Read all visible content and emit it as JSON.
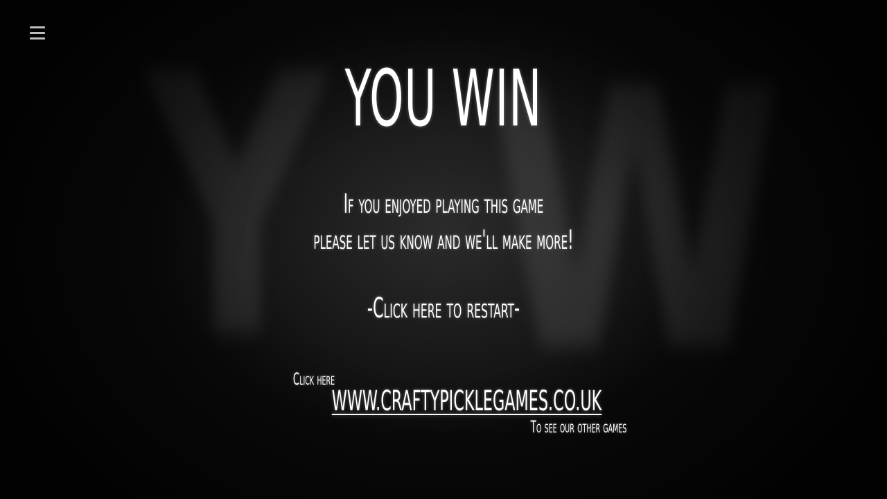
{
  "game": {
    "menu_icon": "hamburger-menu-icon",
    "background_letters": "YW",
    "title": "YOU WIN",
    "message_line_1": "If you enjoyed playing this game",
    "message_line_2": "please let us know and we'll make more!",
    "restart_label": "-Click here to restart-",
    "click_here_label": "Click here",
    "website_label": "WWW.CRAFTYPICKLEGAMES.CO.UK",
    "other_games_label": "To see our other games"
  },
  "colors": {
    "background": "#0b0b0b",
    "text": "#ffffff",
    "menu_icon": "#bdbdbd"
  }
}
